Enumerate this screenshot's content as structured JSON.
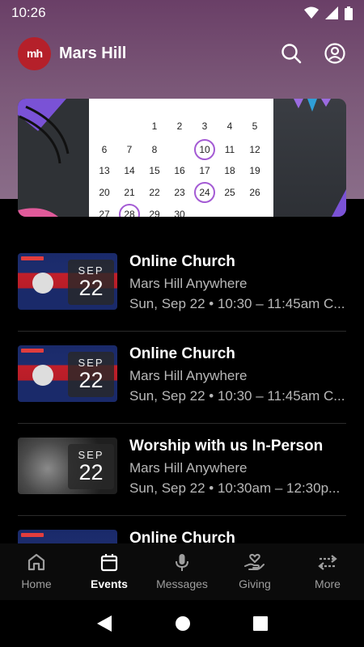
{
  "status": {
    "time": "10:26"
  },
  "header": {
    "title": "Mars Hill",
    "logo_text": "mh"
  },
  "calendar": {
    "rows": [
      [
        "1",
        "2",
        "3",
        "4",
        "5"
      ],
      [
        "6",
        "7",
        "8",
        "10",
        "11",
        "12"
      ],
      [
        "13",
        "14",
        "15",
        "16",
        "17",
        "18",
        "19"
      ],
      [
        "20",
        "21",
        "22",
        "23",
        "24",
        "25",
        "26"
      ],
      [
        "27",
        "28",
        "29",
        "30"
      ]
    ]
  },
  "events": [
    {
      "title": "Online Church",
      "location": "Mars Hill Anywhere",
      "time": "Sun, Sep 22 • 10:30 – 11:45am C...",
      "month": "SEP",
      "day": "22",
      "thumb": "online"
    },
    {
      "title": "Online Church",
      "location": "Mars Hill Anywhere",
      "time": "Sun, Sep 22 • 10:30 – 11:45am C...",
      "month": "SEP",
      "day": "22",
      "thumb": "online"
    },
    {
      "title": "Worship with us In-Person",
      "location": "Mars Hill Anywhere",
      "time": "Sun, Sep 22 • 10:30am – 12:30p...",
      "month": "SEP",
      "day": "22",
      "thumb": "photo"
    },
    {
      "title": "Online Church",
      "location": "",
      "time": "",
      "month": "",
      "day": "",
      "thumb": "online"
    }
  ],
  "tabs": [
    {
      "label": "Home",
      "icon": "home-icon"
    },
    {
      "label": "Events",
      "icon": "calendar-icon",
      "active": true
    },
    {
      "label": "Messages",
      "icon": "microphone-icon"
    },
    {
      "label": "Giving",
      "icon": "giving-hand-icon"
    },
    {
      "label": "More",
      "icon": "swap-arrows-icon"
    }
  ],
  "colors": {
    "accent_ring": "#a45bd4",
    "logo": "#b5202a",
    "header_bg": "#7b5878"
  }
}
